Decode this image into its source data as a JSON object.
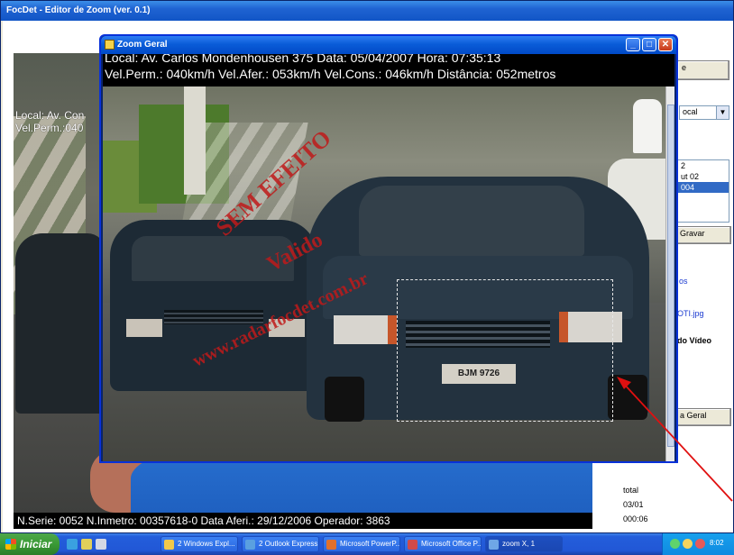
{
  "main_window": {
    "title": "FocDet - Editor de Zoom (ver. 0.1)",
    "overlay_line1": "Local: Av. Con",
    "overlay_line2": "Vel.Perm.:040",
    "bottom_text": "N.Serie: 0052  N.Inmetro: 00357618-0  Data Aferi.: 29/12/2006  Operador: 3863"
  },
  "side_panel": {
    "top_button": "e",
    "select_value": "ocal",
    "list_rows": [
      "2",
      "ut 02",
      "004"
    ],
    "save_button": "Gravar",
    "link1": "os",
    "link2": "OTI.jpg",
    "label_video": "do Vídeo",
    "zoom_button": "a Geral",
    "status1": "total",
    "status2": "03/01",
    "status3": "000:06"
  },
  "zoom_window": {
    "title": "Zoom Geral",
    "header_line1": "Local: Av. Carlos Mondenhousen  375    Data: 05/04/2007  Hora: 07:35:13",
    "header_line2": "Vel.Perm.: 040km/h  Vel.Afer.: 053km/h  Vel.Cons.: 046km/h  Distância: 052metros",
    "plate_text": "BJM 9726",
    "watermark1": "SEM EFEITO",
    "watermark2": "Valido",
    "watermark3": "www.radarfocdet.com.br"
  },
  "taskbar": {
    "start_label": "Iniciar",
    "tasks": [
      "2 Windows Expl...",
      "2 Outlook Express",
      "Microsoft PowerP...",
      "Microsoft Office P...",
      "zoom X, 1"
    ],
    "clock": "8:02"
  },
  "colors": {
    "title_bar_blue": "#1155c6",
    "start_green": "#3a9a36",
    "annotation_red": "#e01010",
    "watermark_red": "#c01a1a"
  }
}
